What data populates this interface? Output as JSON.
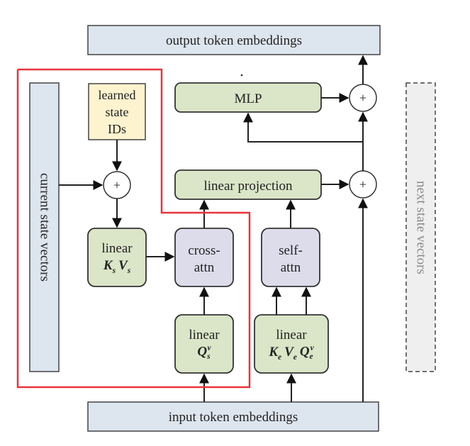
{
  "diagram": {
    "nodes": {
      "output_embeddings": {
        "label": "output token embeddings",
        "fill": "#dde5ef"
      },
      "input_embeddings": {
        "label": "input token embeddings",
        "fill": "#dde5ef"
      },
      "current_state": {
        "label": "current state vectors",
        "fill": "#dde5ef"
      },
      "next_state": {
        "label": "next state vectors",
        "fill": "#efefef"
      },
      "learned_ids": {
        "line1": "learned",
        "line2": "state",
        "line3": "IDs",
        "fill": "#fdf3cf"
      },
      "mlp": {
        "label": "MLP",
        "fill": "#dbe5c8"
      },
      "linear_projection": {
        "label": "linear projection",
        "fill": "#dbe5c8"
      },
      "linear_ks_vs": {
        "label": "linear",
        "math": [
          {
            "b": "K",
            "s": "s"
          },
          {
            "b": "V",
            "s": "s"
          }
        ],
        "fill": "#dbe5c8"
      },
      "cross_attn": {
        "line1": "cross-",
        "line2": "attn",
        "fill": "#dddceb"
      },
      "self_attn": {
        "line1": "self-",
        "line2": "attn",
        "fill": "#dddceb"
      },
      "linear_qs": {
        "label": "linear",
        "math": [
          {
            "b": "Q",
            "s": "s",
            "p": "v"
          }
        ],
        "fill": "#dbe5c8"
      },
      "linear_ke_ve_qe": {
        "label": "linear",
        "math": [
          {
            "b": "K",
            "s": "e"
          },
          {
            "b": "V",
            "s": "e"
          },
          {
            "b": "Q",
            "s": "e",
            "p": "v"
          }
        ],
        "fill": "#dbe5c8"
      },
      "plus_symbol": "+"
    },
    "highlight_color": "#e8343a",
    "line_color": "#222222"
  }
}
